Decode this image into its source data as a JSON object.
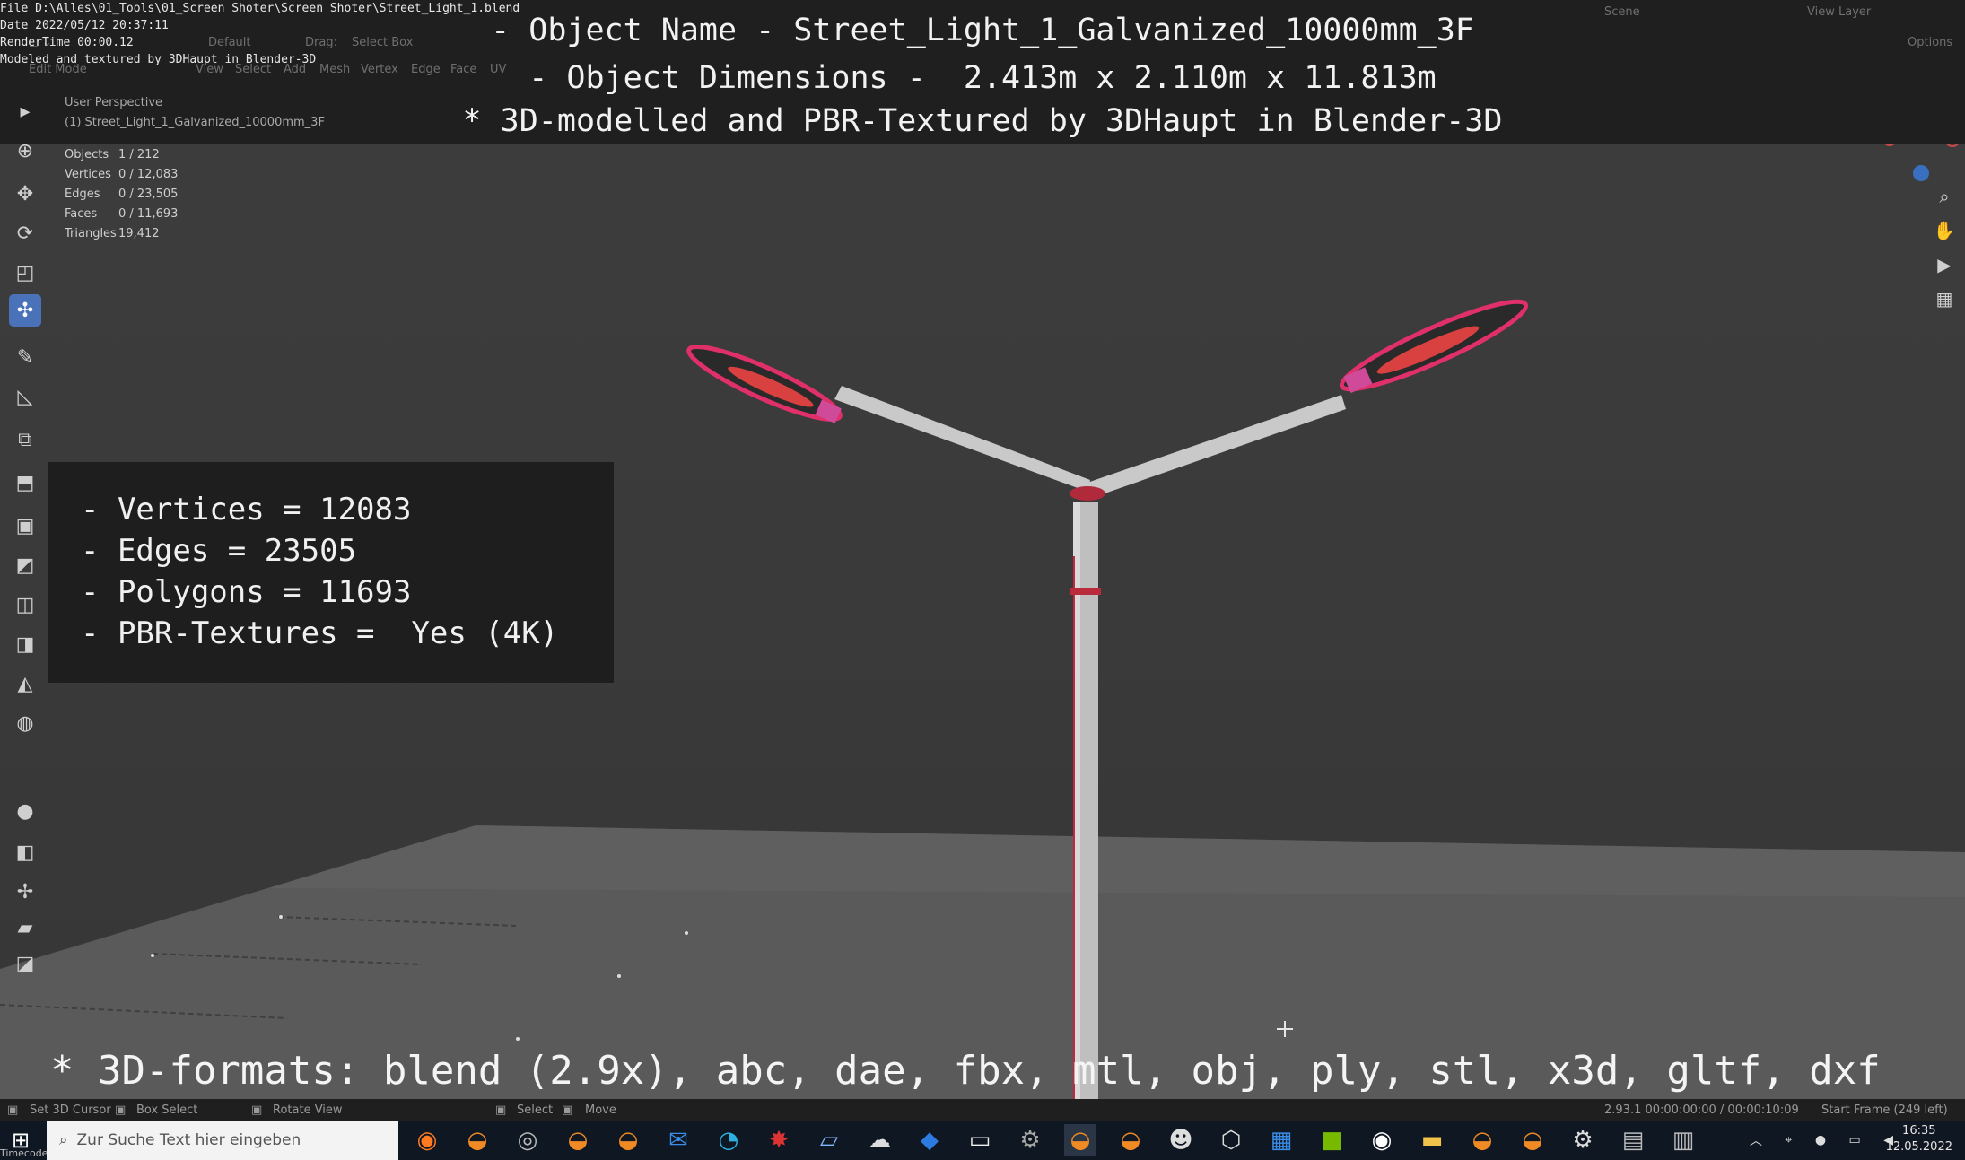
{
  "burnin": {
    "file": "File D:\\Alles\\01_Tools\\01_Screen Shoter\\Screen Shoter\\Street_Light_1.blend",
    "date": "Date 2022/05/12 20:37:11",
    "render_time": "RenderTime 00:00.12",
    "modeled_by": "Modeled and textured by 3DHaupt in Blender-3D",
    "timecode": "Timecode"
  },
  "header": {
    "object_name": "- Object Name - Street_Light_1_Galvanized_10000mm_3F",
    "object_dimensions": "- Object Dimensions -  2.413m x 2.110m x 11.813m",
    "credit": "* 3D-modelled and PBR-Textured by 3DHaupt in Blender-3D"
  },
  "blender_header": {
    "mode": "Edit Mode",
    "menu": [
      "View",
      "Select",
      "Add",
      "Mesh",
      "Vertex",
      "Edge",
      "Face",
      "UV"
    ],
    "orientation": "Default",
    "drag_label": "Drag:",
    "drag_value": "Select Box",
    "scene": "Scene",
    "view_layer": "View Layer",
    "options": "Options"
  },
  "viewport": {
    "perspective": "User Perspective",
    "object": "(1) Street_Light_1_Galvanized_10000mm_3F",
    "stats": [
      {
        "k": "Objects",
        "v": "1 / 212"
      },
      {
        "k": "Vertices",
        "v": "0 / 12,083"
      },
      {
        "k": "Edges",
        "v": "0 / 23,505"
      },
      {
        "k": "Faces",
        "v": "0 / 11,693"
      },
      {
        "k": "Triangles",
        "v": "19,412"
      }
    ]
  },
  "infobox": {
    "vertices": "- Vertices = 12083",
    "edges": "- Edges = 23505",
    "polygons": "- Polygons = 11693",
    "textures": "- PBR-Textures =  Yes (4K)"
  },
  "formats": "* 3D-formats: blend (2.9x), abc, dae, fbx, mtl, obj, ply, stl, x3d, gltf, dxf",
  "statusbar": {
    "set_cursor": "Set 3D Cursor",
    "box_select": "Box Select",
    "rotate_view": "Rotate View",
    "select": "Select",
    "move": "Move",
    "version": "2.93.1  00:00:00:00 / 00:00:10:09",
    "start_frame": "Start Frame (249 left)"
  },
  "taskbar": {
    "search_placeholder": "Zur Suche Text hier eingeben",
    "time": "16:35",
    "date": "12.05.2022"
  },
  "colors": {
    "accent": "#4a72b8",
    "edge_highlight": "#e0306a"
  }
}
